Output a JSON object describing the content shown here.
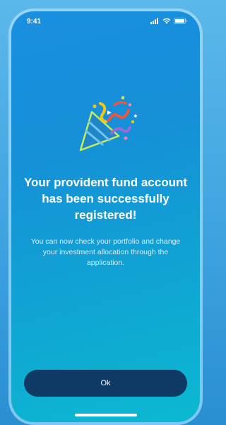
{
  "status_bar": {
    "time": "9:41",
    "icons": [
      "signal-icon",
      "wifi-icon",
      "battery-icon"
    ]
  },
  "illustration": {
    "icon": "party-popper-icon"
  },
  "message": {
    "headline": "Your provident fund account has been successfully registered!",
    "body": "You can now check your portfolio and change your investment allocation through the application."
  },
  "actions": {
    "ok_label": "Ok"
  },
  "colors": {
    "background_top": "#1a8fe0",
    "background_bottom": "#0bb9d1",
    "button": "#0f3a66",
    "text": "#ffffff"
  }
}
